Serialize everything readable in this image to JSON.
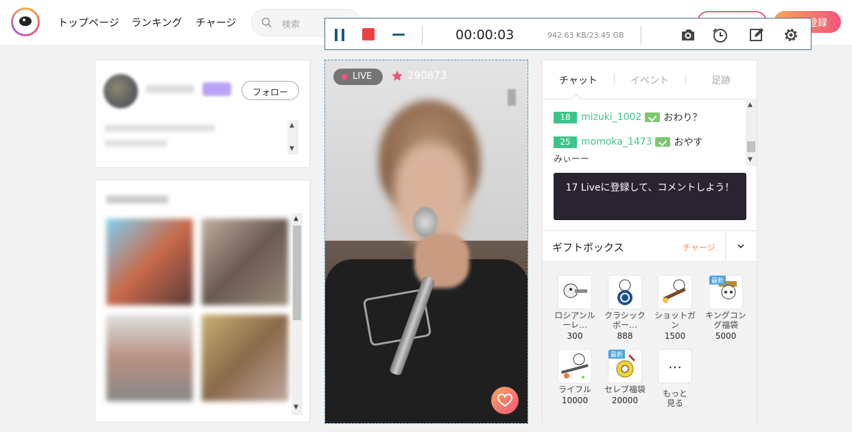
{
  "header": {
    "nav": [
      "トップページ",
      "ランキング",
      "チャージ"
    ],
    "search_placeholder": "検索",
    "register_label": "登録"
  },
  "recorder": {
    "time": "00:00:03",
    "size": "942.63 KB/23.45 GB",
    "icons": [
      "pause-icon",
      "stop-icon",
      "minimize-icon",
      "camera-icon",
      "timer-icon",
      "edit-icon",
      "gear-icon"
    ]
  },
  "profile": {
    "follow_label": "フォロー"
  },
  "video": {
    "live_label": "LIVE",
    "viewers": "290873"
  },
  "chat": {
    "tabs": [
      "チャット",
      "イベント",
      "足跡"
    ],
    "messages": [
      {
        "level": "18",
        "user": "mizuki_1002",
        "text": "おわり？"
      },
      {
        "level": "25",
        "user": "momoka_1473",
        "text": "おやす"
      }
    ],
    "continuation": "みぃーー",
    "register_prompt": "17 Liveに登録して、コメントしよう！"
  },
  "gifts": {
    "title": "ギフトボックス",
    "charge_label": "チャージ",
    "new_label": "最新",
    "items": [
      {
        "name": "ロシアンルーレ…",
        "price": "300"
      },
      {
        "name": "クラシックボー…",
        "price": "888"
      },
      {
        "name": "ショットガン",
        "price": "1500"
      },
      {
        "name": "キングコング福袋",
        "price": "5000"
      },
      {
        "name": "ライフル",
        "price": "10000"
      },
      {
        "name": "セレブ福袋",
        "price": "20000"
      }
    ],
    "more_label": "もっと見る",
    "more_glyph": "…"
  },
  "colors": {
    "accent": "#f0567a",
    "level_badge": "#3cc48a",
    "recorder_border": "#4a6b86"
  }
}
